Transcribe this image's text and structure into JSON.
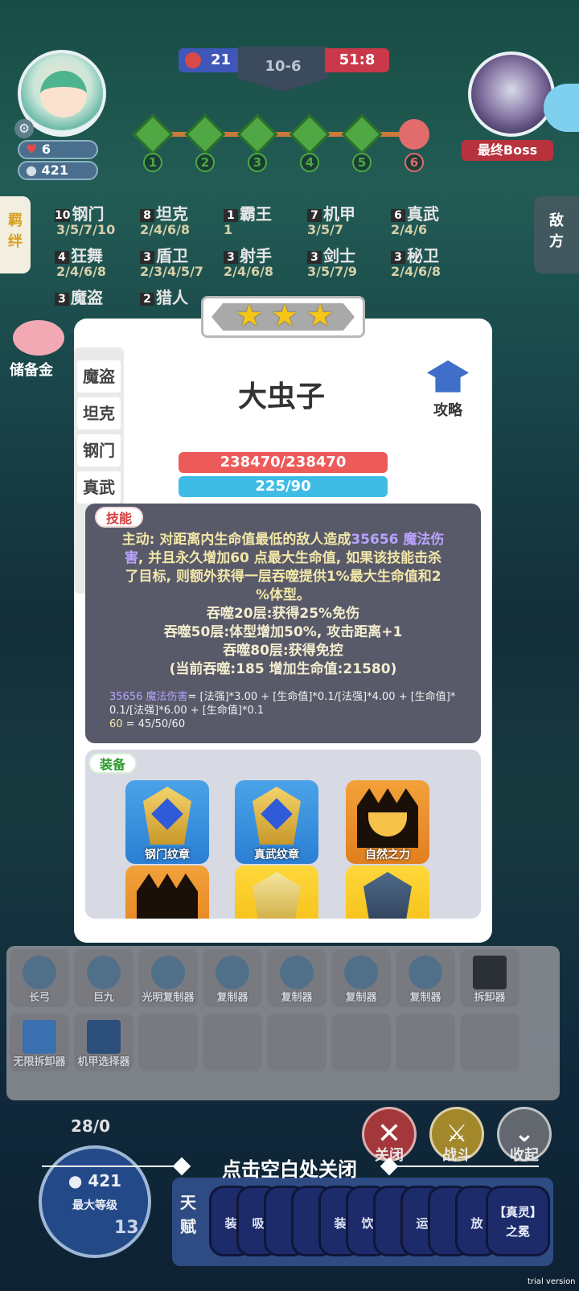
{
  "hud": {
    "hp": "6",
    "coins": "421",
    "score_left": "21",
    "round": "10-6",
    "score_right": "51:8",
    "stages": [
      "1",
      "2",
      "3",
      "4",
      "5",
      "6"
    ],
    "boss_label": "最终Boss"
  },
  "side_tabs": {
    "left": "羁绊",
    "right": "敌方"
  },
  "synergies": [
    {
      "count": "10",
      "name": "钢门",
      "levels": "3/5/7/10"
    },
    {
      "count": "8",
      "name": "坦克",
      "levels": "2/4/6/8"
    },
    {
      "count": "1",
      "name": "霸王",
      "levels": "1"
    },
    {
      "count": "7",
      "name": "机甲",
      "levels": "3/5/7"
    },
    {
      "count": "6",
      "name": "真武",
      "levels": "2/4/6"
    },
    {
      "count": "4",
      "name": "狂舞",
      "levels": "2/4/6/8"
    },
    {
      "count": "3",
      "name": "盾卫",
      "levels": "2/3/4/5/7"
    },
    {
      "count": "3",
      "name": "射手",
      "levels": "2/4/6/8"
    },
    {
      "count": "3",
      "name": "剑士",
      "levels": "3/5/7/9"
    },
    {
      "count": "3",
      "name": "秘卫",
      "levels": "2/4/6/8"
    },
    {
      "count": "3",
      "name": "魔盗",
      "levels": ""
    },
    {
      "count": "2",
      "name": "猎人",
      "levels": ""
    }
  ],
  "piggy_label": "储备金",
  "modal": {
    "stars": 3,
    "tabs": [
      "魔盗",
      "坦克",
      "钢门",
      "真武"
    ],
    "unit_name": "大虫子",
    "guide_label": "攻略",
    "hp_bar": "238470/238470",
    "mp_bar": "225/90",
    "skill_tag": "技能",
    "skill": {
      "l1a": "主动: 对距离内生命值最低的敌人造成",
      "l1b": "35656 魔法伤",
      "l2a": "害",
      "l2b": ", 并且永久增加",
      "l2c": "60",
      "l2d": " 点最大生命值, 如果该技能击杀",
      "l3": "了目标, 则额外获得一层吞噬提供1%最大生命值和2",
      "l4": "%体型。",
      "l5": "吞噬20层:获得25%免伤",
      "l6": "吞噬50层:体型增加50%, 攻击距离+1",
      "l7": "吞噬80层:获得免控",
      "l8": "(当前吞噬:185 增加生命值:21580)"
    },
    "formula": {
      "f1": "35656 魔法伤害",
      "f2": "= [法强]*3.00 + [生命值]*0.1/[法强]*4.00 + [生命值]*",
      "f3": "0.1/[法强]*6.00 + [生命值]*0.1",
      "f4": "60",
      "f5": " = 45/50/60"
    },
    "equip_tag": "装备",
    "equipment": [
      "钢门纹章",
      "真武纹章",
      "自然之力",
      "",
      "",
      ""
    ]
  },
  "inventory": [
    "长弓",
    "巨九",
    "光明复制器",
    "复制器",
    "复制器",
    "复制器",
    "复制器",
    "拆卸器",
    "无限拆卸器",
    "机甲选择器"
  ],
  "bottom": {
    "level_count": "28/0",
    "coins": "421",
    "level_label": "最大等级",
    "level_num": "13",
    "btn_close": "关闭",
    "btn_fight": "战斗",
    "btn_collapse": "收起",
    "close_hint": "点击空白处关闭",
    "talent_label": "天赋",
    "talent_cards": [
      "装",
      "吸",
      "",
      "",
      "装",
      "饮",
      "",
      "运",
      "",
      "放"
    ],
    "talent_last": "【真灵】之冕",
    "trial": "trial version"
  }
}
